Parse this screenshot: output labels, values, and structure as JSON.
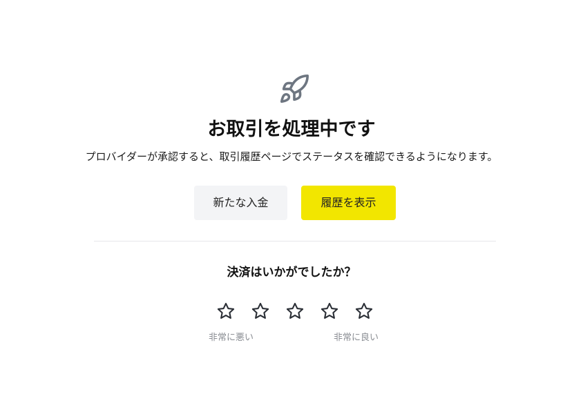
{
  "status": {
    "icon": "rocket-icon",
    "title": "お取引を処理中です",
    "message": "プロバイダーが承認すると、取引履歴ページでステータスを確認できるようになります。"
  },
  "actions": {
    "new_deposit_label": "新たな入金",
    "view_history_label": "履歴を表示"
  },
  "rating": {
    "question": "決済はいかがでしたか？",
    "stars": 5,
    "selected": 0,
    "icon": "star-icon",
    "low_label": "非常に悪い",
    "high_label": "非常に良い"
  },
  "colors": {
    "primary_button": "#f2e600",
    "secondary_button": "#f3f4f6",
    "icon": "#6e7681",
    "muted_text": "#8a8d93",
    "divider": "#e6e7ea"
  }
}
